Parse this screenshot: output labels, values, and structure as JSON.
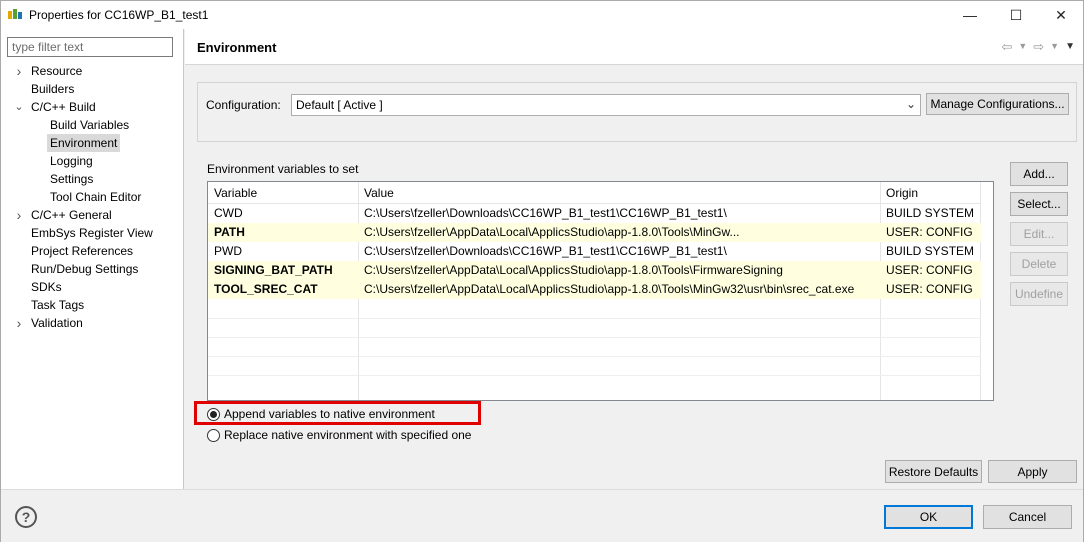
{
  "window": {
    "title": "Properties for CC16WP_B1_test1",
    "minimize_glyph": "—",
    "maximize_glyph": "☐",
    "close_glyph": "✕"
  },
  "filter": {
    "placeholder": "type filter text",
    "value": ""
  },
  "tree": [
    {
      "label": "Resource",
      "level": 0,
      "expander": "collapsed"
    },
    {
      "label": "Builders",
      "level": 0,
      "expander": "none"
    },
    {
      "label": "C/C++ Build",
      "level": 0,
      "expander": "expanded"
    },
    {
      "label": "Build Variables",
      "level": 1,
      "expander": "none"
    },
    {
      "label": "Environment",
      "level": 1,
      "expander": "none",
      "selected": true
    },
    {
      "label": "Logging",
      "level": 1,
      "expander": "none"
    },
    {
      "label": "Settings",
      "level": 1,
      "expander": "none"
    },
    {
      "label": "Tool Chain Editor",
      "level": 1,
      "expander": "none"
    },
    {
      "label": "C/C++ General",
      "level": 0,
      "expander": "collapsed"
    },
    {
      "label": "EmbSys Register View",
      "level": 0,
      "expander": "none"
    },
    {
      "label": "Project References",
      "level": 0,
      "expander": "none"
    },
    {
      "label": "Run/Debug Settings",
      "level": 0,
      "expander": "none"
    },
    {
      "label": "SDKs",
      "level": 0,
      "expander": "none"
    },
    {
      "label": "Task Tags",
      "level": 0,
      "expander": "none"
    },
    {
      "label": "Validation",
      "level": 0,
      "expander": "collapsed"
    }
  ],
  "page": {
    "title": "Environment"
  },
  "configuration": {
    "label": "Configuration:",
    "selected": "Default  [ Active ]",
    "manage_label": "Manage Configurations..."
  },
  "env": {
    "caption": "Environment variables to set",
    "columns": [
      "Variable",
      "Value",
      "Origin"
    ],
    "rows": [
      {
        "variable": "CWD",
        "value": "C:\\Users\\fzeller\\Downloads\\CC16WP_B1_test1\\CC16WP_B1_test1\\",
        "origin": "BUILD SYSTEM",
        "user": false
      },
      {
        "variable": "PATH",
        "value": "C:\\Users\\fzeller\\AppData\\Local\\ApplicsStudio\\app-1.8.0\\Tools\\MinGw...",
        "origin": "USER: CONFIG",
        "user": true
      },
      {
        "variable": "PWD",
        "value": "C:\\Users\\fzeller\\Downloads\\CC16WP_B1_test1\\CC16WP_B1_test1\\",
        "origin": "BUILD SYSTEM",
        "user": false
      },
      {
        "variable": "SIGNING_BAT_PATH",
        "value": "C:\\Users\\fzeller\\AppData\\Local\\ApplicsStudio\\app-1.8.0\\Tools\\FirmwareSigning",
        "origin": "USER: CONFIG",
        "user": true
      },
      {
        "variable": "TOOL_SREC_CAT",
        "value": "C:\\Users\\fzeller\\AppData\\Local\\ApplicsStudio\\app-1.8.0\\Tools\\MinGw32\\usr\\bin\\srec_cat.exe",
        "origin": "USER: CONFIG",
        "user": true
      }
    ],
    "buttons": {
      "add": "Add...",
      "select": "Select...",
      "edit": "Edit...",
      "delete": "Delete",
      "undefine": "Undefine"
    }
  },
  "mode": {
    "append_label": "Append variables to native environment",
    "replace_label": "Replace native environment with specified one",
    "selected": "append"
  },
  "actions": {
    "restore_defaults": "Restore Defaults",
    "apply": "Apply",
    "ok": "OK",
    "cancel": "Cancel",
    "help_glyph": "?"
  },
  "colors": {
    "user_row_bg": "#ffffe0",
    "highlight_border": "#e00000",
    "primary_border": "#0078d7"
  }
}
